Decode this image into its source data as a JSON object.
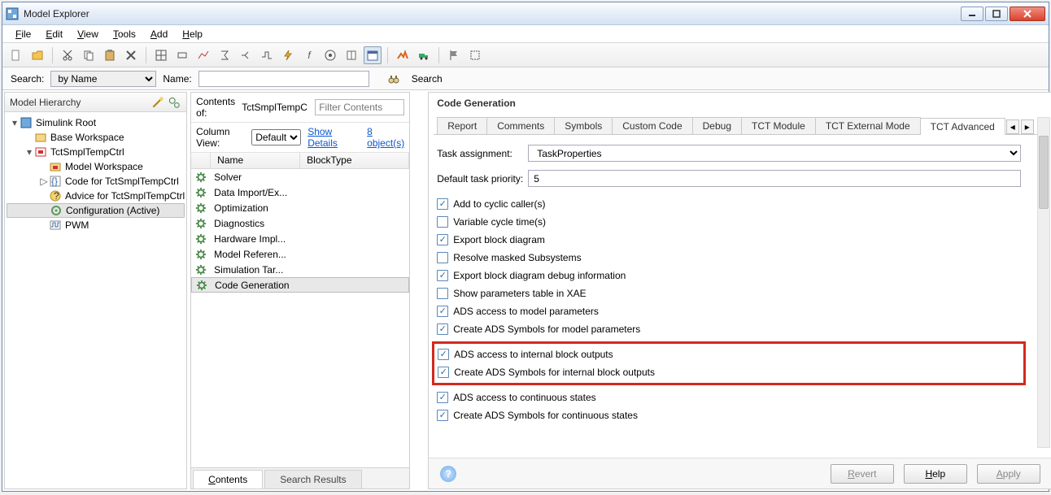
{
  "window": {
    "title": "Model Explorer"
  },
  "menus": {
    "file": "File",
    "edit": "Edit",
    "view": "View",
    "tools": "Tools",
    "add": "Add",
    "help": "Help"
  },
  "searchbar": {
    "search_label": "Search:",
    "by_value": "by Name",
    "name_label": "Name:",
    "name_value": "",
    "search_btn": "Search"
  },
  "hierarchy": {
    "title": "Model Hierarchy",
    "root": "Simulink Root",
    "items": [
      {
        "label": "Base Workspace",
        "depth": 1
      },
      {
        "label": "TctSmplTempCtrl",
        "depth": 1,
        "expanded": true
      },
      {
        "label": "Model Workspace",
        "depth": 2
      },
      {
        "label": "Code for TctSmplTempCtrl",
        "depth": 2,
        "twist": "▷"
      },
      {
        "label": "Advice for TctSmplTempCtrl",
        "depth": 2
      },
      {
        "label": "Configuration (Active)",
        "depth": 2,
        "selected": true
      },
      {
        "label": "PWM",
        "depth": 2
      }
    ]
  },
  "contents": {
    "label": "Contents of:",
    "value": "TctSmplTempC",
    "filter_ph": "Filter Contents",
    "colview_label": "Column View:",
    "colview_value": "Default",
    "show_details": "Show Details",
    "object_link": "8 object(s)",
    "cols": {
      "name": "Name",
      "blocktype": "BlockType"
    },
    "rows": [
      "Solver",
      "Data Import/Ex...",
      "Optimization",
      "Diagnostics",
      "Hardware Impl...",
      "Model Referen...",
      "Simulation Tar...",
      "Code Generation"
    ],
    "selected_index": 7,
    "tabs": {
      "contents": "Contents",
      "search_results": "Search Results"
    }
  },
  "right": {
    "title": "Code Generation",
    "tabs": [
      "Report",
      "Comments",
      "Symbols",
      "Custom Code",
      "Debug",
      "TCT Module",
      "TCT External Mode",
      "TCT Advanced"
    ],
    "active_tab": 7,
    "task_label": "Task assignment:",
    "task_value": "TaskProperties",
    "prio_label": "Default task priority:",
    "prio_value": "5",
    "checks": [
      {
        "label": "Add to cyclic caller(s)",
        "on": true
      },
      {
        "label": "Variable cycle time(s)",
        "on": false
      },
      {
        "label": "Export block diagram",
        "on": true
      },
      {
        "label": "Resolve masked Subsystems",
        "on": false
      },
      {
        "label": "Export block diagram debug information",
        "on": true
      },
      {
        "label": "Show parameters table in XAE",
        "on": false
      },
      {
        "label": "ADS access to model parameters",
        "on": true
      },
      {
        "label": "Create ADS Symbols for model parameters",
        "on": true
      },
      {
        "label": "ADS access to internal block outputs",
        "on": true,
        "hl": true
      },
      {
        "label": "Create ADS Symbols for internal block outputs",
        "on": true,
        "hl": true
      },
      {
        "label": "ADS access to continuous states",
        "on": true
      },
      {
        "label": "Create ADS Symbols for continuous states",
        "on": true
      }
    ],
    "buttons": {
      "revert": "Revert",
      "help": "Help",
      "apply": "Apply"
    }
  }
}
